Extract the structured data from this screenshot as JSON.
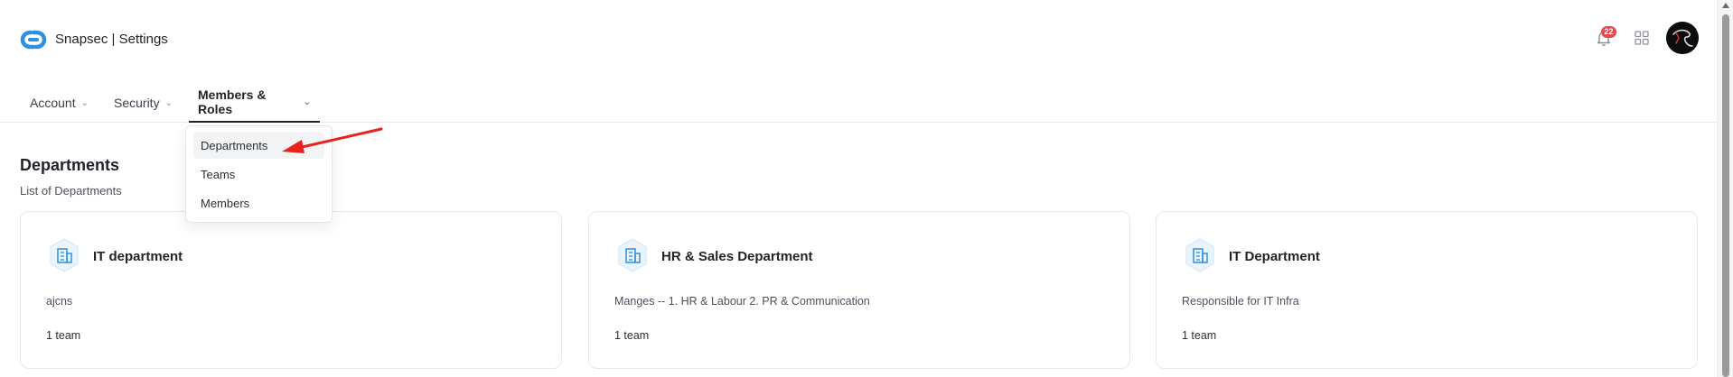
{
  "header": {
    "app_title": "Snapsec | Settings",
    "notification_count": "22",
    "brand_color": "#2f8fe0",
    "badge_color": "#e5484d"
  },
  "tabs": [
    {
      "label": "Account",
      "icon": "chevron-down-icon"
    },
    {
      "label": "Security",
      "icon": "chevron-down-icon"
    },
    {
      "label": "Members & Roles",
      "icon": "chevron-down-icon",
      "active": true
    }
  ],
  "dropdown": {
    "items": [
      {
        "label": "Departments",
        "hovered": true
      },
      {
        "label": "Teams"
      },
      {
        "label": "Members"
      }
    ]
  },
  "section": {
    "title": "Departments",
    "subtitle": "List of Departments"
  },
  "departments": [
    {
      "name": "IT department",
      "description": "ajcns",
      "teams": "1 team",
      "icon": "building-icon"
    },
    {
      "name": "HR & Sales Department",
      "description": "Manges -- 1. HR & Labour 2. PR & Communication",
      "teams": "1 team",
      "icon": "building-icon"
    },
    {
      "name": "IT Department",
      "description": "Responsible for IT Infra",
      "teams": "1 team",
      "icon": "building-icon"
    }
  ],
  "annotation": {
    "arrow_color": "#e8211d"
  }
}
